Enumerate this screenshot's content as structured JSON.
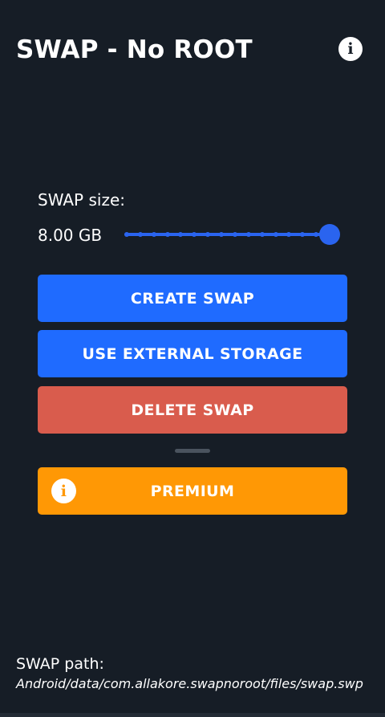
{
  "header": {
    "title": "SWAP - No ROOT",
    "info_icon": "info-icon",
    "info_glyph": "i"
  },
  "swap_size": {
    "label": "SWAP size:",
    "value": "8.00 GB",
    "slider": {
      "steps": 16,
      "position_fraction": 1.0,
      "color": "#2a64ef"
    }
  },
  "buttons": {
    "create": "CREATE SWAP",
    "external": "USE EXTERNAL STORAGE",
    "delete": "DELETE SWAP",
    "premium": "PREMIUM",
    "premium_icon": "info-icon",
    "premium_glyph": "i"
  },
  "colors": {
    "background": "#161d26",
    "primary": "#1f6bff",
    "danger": "#d95c4d",
    "premium": "#ff9805"
  },
  "footer": {
    "path_label": "SWAP path:",
    "path_value": "Android/data/com.allakore.swapnoroot/files/swap.swp"
  }
}
